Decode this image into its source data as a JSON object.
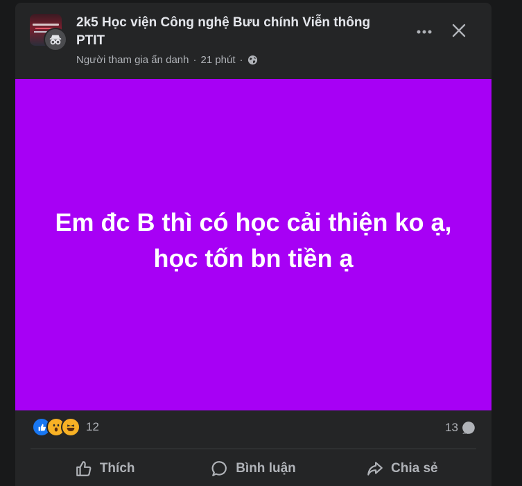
{
  "post": {
    "group_name": "2k5 Học viện Công nghệ Bưu chính Viễn thông PTIT",
    "author": "Người tham gia ẩn danh",
    "separator": "·",
    "time": "21 phút",
    "content_text": "Em đc B thì có học cải thiện ko ạ, học tốn bn tiền ạ",
    "background_color": "#a700f5"
  },
  "reactions": {
    "icons": [
      "like-icon",
      "wow-icon",
      "haha-icon"
    ],
    "count": "12",
    "comment_count": "13"
  },
  "actions": {
    "like_label": "Thích",
    "comment_label": "Bình luận",
    "share_label": "Chia sẻ"
  },
  "colors": {
    "page_bg": "#18191a",
    "card_bg": "#242526",
    "text_primary": "#e4e6eb",
    "text_secondary": "#b0b3b8",
    "like_blue": "#1877f2"
  }
}
